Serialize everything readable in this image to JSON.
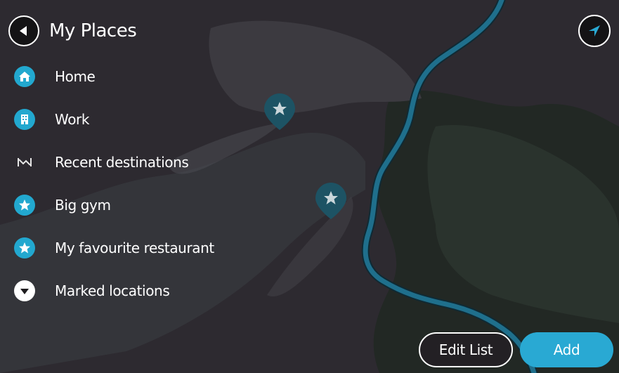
{
  "header": {
    "title": "My Places",
    "back_icon": "back-arrow-icon"
  },
  "places": [
    {
      "label": "Home",
      "icon": "home-icon"
    },
    {
      "label": "Work",
      "icon": "work-building-icon"
    },
    {
      "label": "Recent destinations",
      "icon": "recent-route-icon"
    },
    {
      "label": "Big gym",
      "icon": "star-icon"
    },
    {
      "label": "My favourite restaurant",
      "icon": "star-icon"
    },
    {
      "label": "Marked locations",
      "icon": "chevron-down-icon"
    }
  ],
  "actions": {
    "edit_label": "Edit List",
    "add_label": "Add"
  },
  "colors": {
    "accent": "#29a9d3",
    "route": "#1f6f8c",
    "pin": "#1d5364",
    "map_background": "#2b2830"
  }
}
